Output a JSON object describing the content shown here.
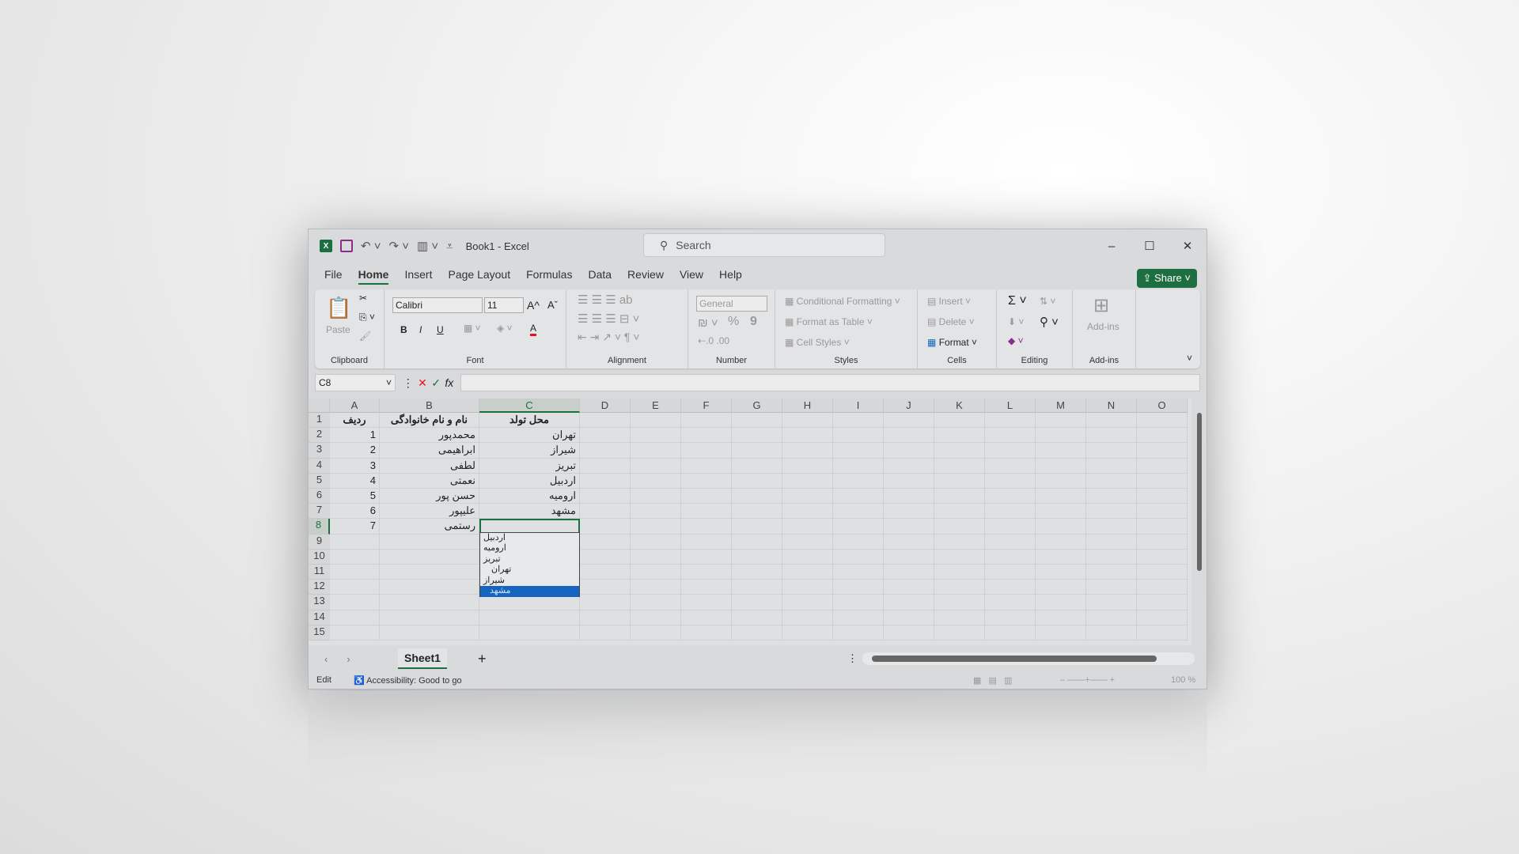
{
  "window": {
    "title": "Book1  -  Excel",
    "search_placeholder": "Search",
    "minimize": "–",
    "maximize": "☐",
    "close": "✕"
  },
  "menu": {
    "tabs": [
      "File",
      "Home",
      "Insert",
      "Page Layout",
      "Formulas",
      "Data",
      "Review",
      "View",
      "Help"
    ],
    "active": "Home",
    "share": "Share"
  },
  "ribbon": {
    "clipboard": {
      "label": "Clipboard",
      "paste": "Paste"
    },
    "font": {
      "label": "Font",
      "name": "Calibri",
      "size": "11",
      "bold": "B",
      "italic": "I",
      "underline": "U",
      "grow": "A^",
      "shrink": "Aˇ",
      "color": "A",
      "font_color": "#e81123"
    },
    "alignment": {
      "label": "Alignment"
    },
    "number": {
      "label": "Number",
      "format": "General",
      "percent": "%",
      "comma": "9"
    },
    "styles": {
      "label": "Styles",
      "conditional": "Conditional Formatting",
      "format_table": "Format as Table",
      "cell_styles": "Cell Styles"
    },
    "cells": {
      "label": "Cells",
      "insert": "Insert",
      "delete": "Delete",
      "format": "Format"
    },
    "editing": {
      "label": "Editing",
      "sum": "Σ"
    },
    "addins": {
      "label": "Add-ins",
      "button": "Add-ins"
    }
  },
  "formula_bar": {
    "name_box": "C8",
    "fx": "fx",
    "value": ""
  },
  "grid": {
    "columns": [
      "A",
      "B",
      "C",
      "D",
      "E",
      "F",
      "G",
      "H",
      "I",
      "J",
      "K",
      "L",
      "M",
      "N",
      "O"
    ],
    "selected_column": "C",
    "selected_row": 8,
    "rows": [
      [
        "ردیف",
        "نام و نام خانوادگی",
        "محل تولد"
      ],
      [
        "1",
        "محمدپور",
        "تهران"
      ],
      [
        "2",
        "ابراهیمی",
        "شیراز"
      ],
      [
        "3",
        "لطفی",
        "تبریز"
      ],
      [
        "4",
        "نعمتی",
        "اردبیل"
      ],
      [
        "5",
        "حسن پور",
        "ارومیه"
      ],
      [
        "6",
        "علیپور",
        "مشهد"
      ],
      [
        "7",
        "رستمی",
        ""
      ]
    ],
    "row_count": 15,
    "dropdown": {
      "items": [
        "اردبیل",
        "ارومیه",
        "تبریز",
        "تهران",
        "شیراز",
        "مشهد"
      ],
      "highlighted": "مشهد"
    }
  },
  "sheets": {
    "tabs": [
      "Sheet1"
    ],
    "active": "Sheet1",
    "add": "+"
  },
  "status": {
    "mode": "Edit",
    "accessibility": "Accessibility: Good to go",
    "zoom": "100 %"
  },
  "colors": {
    "accent": "#1d6f42",
    "highlight": "#1565c0"
  }
}
